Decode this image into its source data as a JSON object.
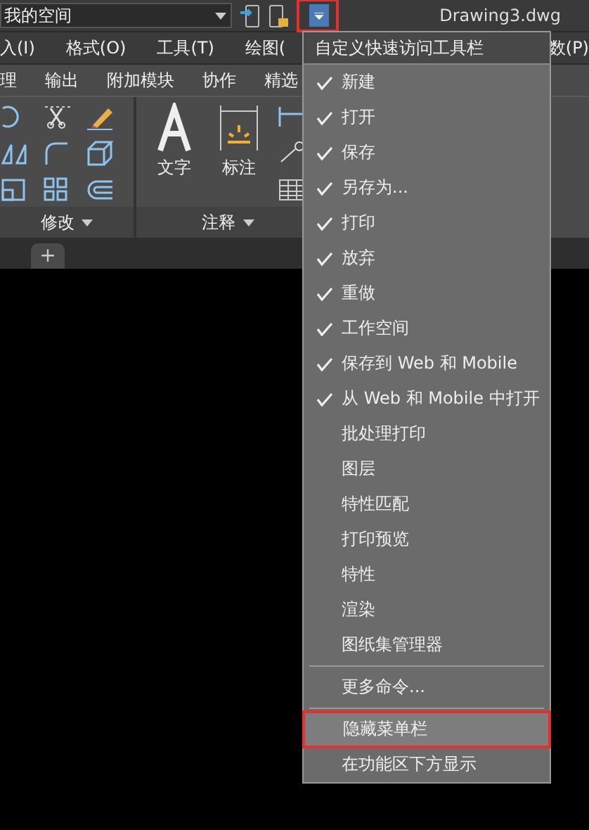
{
  "title_bar": {
    "workspace": "我的空间",
    "document": "Drawing3.dwg",
    "menu_button_highlighted": true
  },
  "menu_bar": [
    "入(I)",
    "格式(O)",
    "工具(T)",
    "绘图(",
    "数(P)"
  ],
  "ribbon_tabs": [
    "理",
    "输出",
    "附加模块",
    "协作",
    "精选"
  ],
  "ribbon_tools": [
    {
      "label": "文字",
      "kind": "text"
    },
    {
      "label": "标注",
      "kind": "dimension"
    }
  ],
  "panels": [
    {
      "label": "修改"
    },
    {
      "label": "注释"
    }
  ],
  "doc_tabs": [
    {
      "label": "+"
    }
  ],
  "menu": {
    "title": "自定义快速访问工具栏",
    "items": [
      {
        "kind": "item",
        "label": "新建",
        "checked": true,
        "highlighted": false
      },
      {
        "kind": "item",
        "label": "打开",
        "checked": true,
        "highlighted": false
      },
      {
        "kind": "item",
        "label": "保存",
        "checked": true,
        "highlighted": false
      },
      {
        "kind": "item",
        "label": "另存为...",
        "checked": true,
        "highlighted": false
      },
      {
        "kind": "item",
        "label": "打印",
        "checked": true,
        "highlighted": false
      },
      {
        "kind": "item",
        "label": "放弃",
        "checked": true,
        "highlighted": false
      },
      {
        "kind": "item",
        "label": "重做",
        "checked": true,
        "highlighted": false
      },
      {
        "kind": "item",
        "label": "工作空间",
        "checked": true,
        "highlighted": false
      },
      {
        "kind": "item",
        "label": "保存到 Web 和 Mobile",
        "checked": true,
        "highlighted": false
      },
      {
        "kind": "item",
        "label": "从 Web 和 Mobile 中打开",
        "checked": true,
        "highlighted": false
      },
      {
        "kind": "item",
        "label": "批处理打印",
        "checked": false,
        "highlighted": false
      },
      {
        "kind": "item",
        "label": "图层",
        "checked": false,
        "highlighted": false
      },
      {
        "kind": "item",
        "label": "特性匹配",
        "checked": false,
        "highlighted": false
      },
      {
        "kind": "item",
        "label": "打印预览",
        "checked": false,
        "highlighted": false
      },
      {
        "kind": "item",
        "label": "特性",
        "checked": false,
        "highlighted": false
      },
      {
        "kind": "item",
        "label": "渲染",
        "checked": false,
        "highlighted": false
      },
      {
        "kind": "item",
        "label": "图纸集管理器",
        "checked": false,
        "highlighted": false
      },
      {
        "kind": "separator"
      },
      {
        "kind": "item",
        "label": "更多命令...",
        "checked": false,
        "highlighted": false
      },
      {
        "kind": "separator"
      },
      {
        "kind": "item",
        "label": "隐藏菜单栏",
        "checked": false,
        "highlighted": true
      },
      {
        "kind": "item",
        "label": "在功能区下方显示",
        "checked": false,
        "highlighted": false
      }
    ]
  }
}
